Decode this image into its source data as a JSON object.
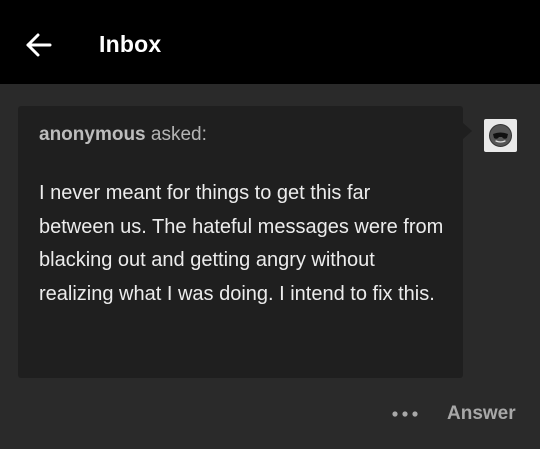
{
  "header": {
    "title": "Inbox",
    "back_icon": "arrow-left-icon"
  },
  "ask": {
    "asker_name": "anonymous",
    "asked_label": " asked:",
    "message": "I never meant for things to get this far between us. The hateful messages were from blacking out and getting angry without realizing what I was doing. I intend to fix this.",
    "avatar_icon": "anonymous-avatar-icon"
  },
  "actions": {
    "more_icon": "more-dots-icon",
    "answer_label": "Answer"
  },
  "colors": {
    "header_bg": "#000000",
    "page_bg": "#2a2a2a",
    "card_bg": "#1f1f1f"
  }
}
